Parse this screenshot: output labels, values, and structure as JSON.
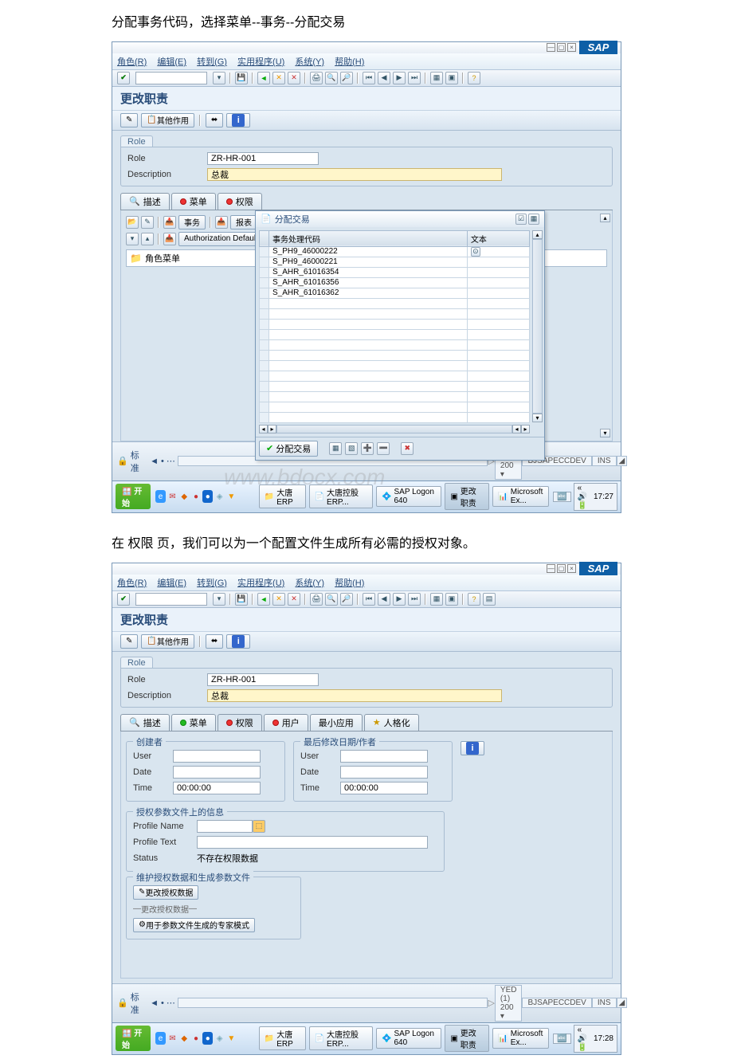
{
  "doc": {
    "line1": "分配事务代码，选择菜单--事务--分配交易",
    "line2": "在 权限 页，我们可以为一个配置文件生成所有必需的授权对象。"
  },
  "win1": {
    "menu": {
      "m1": "角色(R)",
      "m2": "编辑(E)",
      "m3": "转到(G)",
      "m4": "实用程序(U)",
      "m5": "系统(Y)",
      "m6": "帮助(H)"
    },
    "title": "更改职责",
    "apptb": {
      "b1": "其他作用"
    },
    "role": {
      "label": "Role",
      "code": "ZR-HR-001",
      "desc_label": "Description",
      "desc": "总裁"
    },
    "tabs": {
      "t1": "描述",
      "t2": "菜单",
      "t3": "权限",
      "btn1": "事务",
      "btn2": "报表",
      "btn3": "Authorization Default"
    },
    "tree": {
      "root": "角色菜单"
    },
    "dialog": {
      "title": "分配交易",
      "col1": "事务处理代码",
      "col2": "文本",
      "rows": [
        "S_PH9_46000222",
        "S_PH9_46000221",
        "S_AHR_61016354",
        "S_AHR_61016356",
        "S_AHR_61016362"
      ],
      "btn": "分配交易"
    },
    "status": {
      "tag": "标准",
      "right": "YED (1) 200",
      "host": "BJSAPECCDEV",
      "mode": "INS"
    },
    "taskbar": {
      "start": "开始",
      "t1": "大唐ERP",
      "t2": "大唐控股ERP...",
      "t3": "SAP Logon 640",
      "t4": "更改职责",
      "tray1": "Microsoft Ex...",
      "time": "17:27"
    }
  },
  "win2": {
    "menu": {
      "m1": "角色(R)",
      "m2": "编辑(E)",
      "m3": "转到(G)",
      "m4": "实用程序(U)",
      "m5": "系统(Y)",
      "m6": "帮助(H)"
    },
    "title": "更改职责",
    "apptb": {
      "b1": "其他作用"
    },
    "role": {
      "label": "Role",
      "code": "ZR-HR-001",
      "desc_label": "Description",
      "desc": "总裁"
    },
    "tabs": {
      "t1": "描述",
      "t2": "菜单",
      "t3": "权限",
      "t4": "用户",
      "t5": "最小应用",
      "t6": "人格化"
    },
    "g1": {
      "title": "创建者",
      "user": "User",
      "date": "Date",
      "time": "Time",
      "timev": "00:00:00"
    },
    "g2": {
      "title": "最后修改日期/作者",
      "user": "User",
      "date": "Date",
      "time": "Time",
      "timev": "00:00:00"
    },
    "g3": {
      "title": "授权参数文件上的信息",
      "p1": "Profile Name",
      "p2": "Profile Text",
      "p3": "Status",
      "status": "不存在权限数据"
    },
    "g4": {
      "title": "维护授权数据和生成参数文件",
      "b1": "更改授权数据",
      "b2": "更改授权数据",
      "b3": "用于参数文件生成的专家模式"
    },
    "status": {
      "tag": "标准",
      "right": "YED (1) 200",
      "host": "BJSAPECCDEV",
      "mode": "INS"
    },
    "taskbar": {
      "start": "开始",
      "t1": "大唐ERP",
      "t2": "大唐控股ERP...",
      "t3": "SAP Logon 640",
      "t4": "更改职责",
      "tray1": "Microsoft Ex...",
      "time": "17:28"
    }
  }
}
